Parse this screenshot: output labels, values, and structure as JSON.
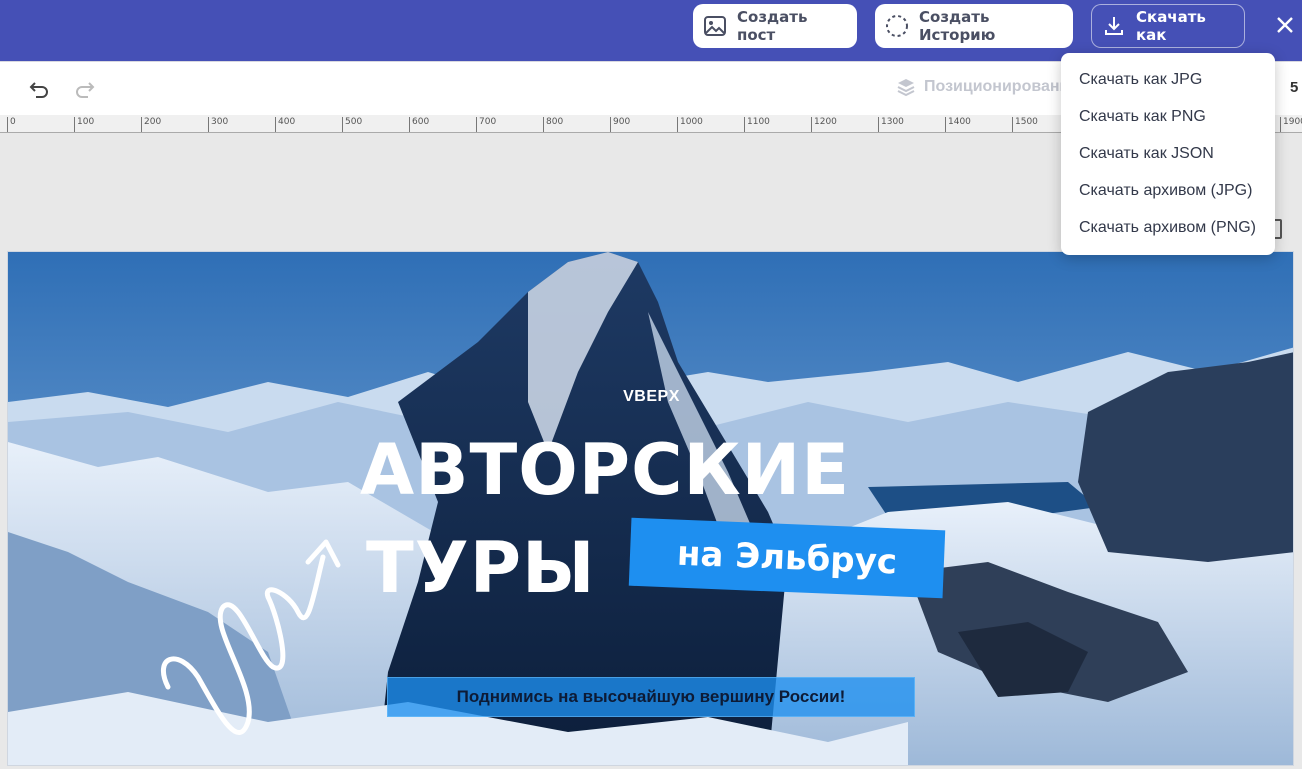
{
  "header": {
    "create_post": "Создать пост",
    "create_story": "Создать Историю",
    "download_as": "Скачать как",
    "icons": {
      "post": "image-icon",
      "story": "dashed-circle-icon",
      "download": "download-icon",
      "close": "close-icon"
    }
  },
  "toolbar": {
    "positioning_label": "Позиционирование",
    "zoom_fragment": "5"
  },
  "ruler": {
    "ticks": [
      "0",
      "100",
      "200",
      "300",
      "400",
      "500",
      "600",
      "700",
      "800",
      "900",
      "1000",
      "1100",
      "1200",
      "1300",
      "1400",
      "1500",
      "1600",
      "1700",
      "1800",
      "1900"
    ]
  },
  "download_menu": {
    "items": [
      "Скачать как JPG",
      "Скачать как PNG",
      "Скачать как JSON",
      "Скачать архивом (JPG)",
      "Скачать архивом (PNG)"
    ]
  },
  "canvas": {
    "brand": "VBEPX",
    "title_line1": "АВТОРСКИЕ",
    "title_line2": "ТУРЫ",
    "tag": "на Эльбрус",
    "subtitle": "Поднимись на высочайшую вершину России!"
  },
  "colors": {
    "header_bg": "#4550b6",
    "accent_blue": "#1e8ff0",
    "toolbar_bg": "#ffffff",
    "workspace_bg": "#e8e8e8"
  }
}
